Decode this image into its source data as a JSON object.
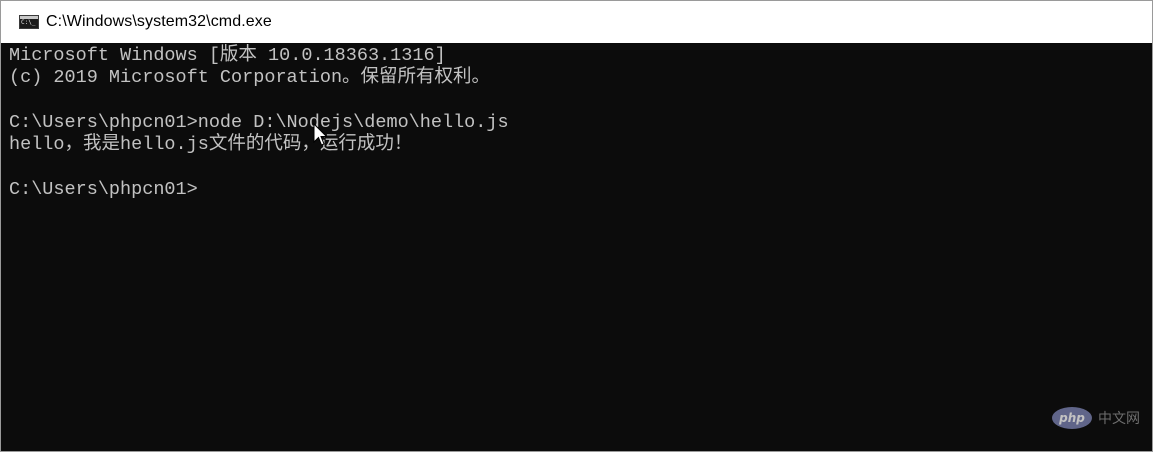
{
  "window": {
    "title": "C:\\Windows\\system32\\cmd.exe",
    "icon": "cmd-icon"
  },
  "console": {
    "lines": [
      "Microsoft Windows [版本 10.0.18363.1316]",
      "(c) 2019 Microsoft Corporation。保留所有权利。",
      "",
      "C:\\Users\\phpcn01>node D:\\Nodejs\\demo\\hello.js",
      "hello，我是hello.js文件的代码，运行成功！",
      "",
      "C:\\Users\\phpcn01>"
    ],
    "colors": {
      "background": "#0c0c0c",
      "text": "#c2c2c2"
    }
  },
  "watermark": {
    "badge": "php",
    "text": "中文网"
  }
}
